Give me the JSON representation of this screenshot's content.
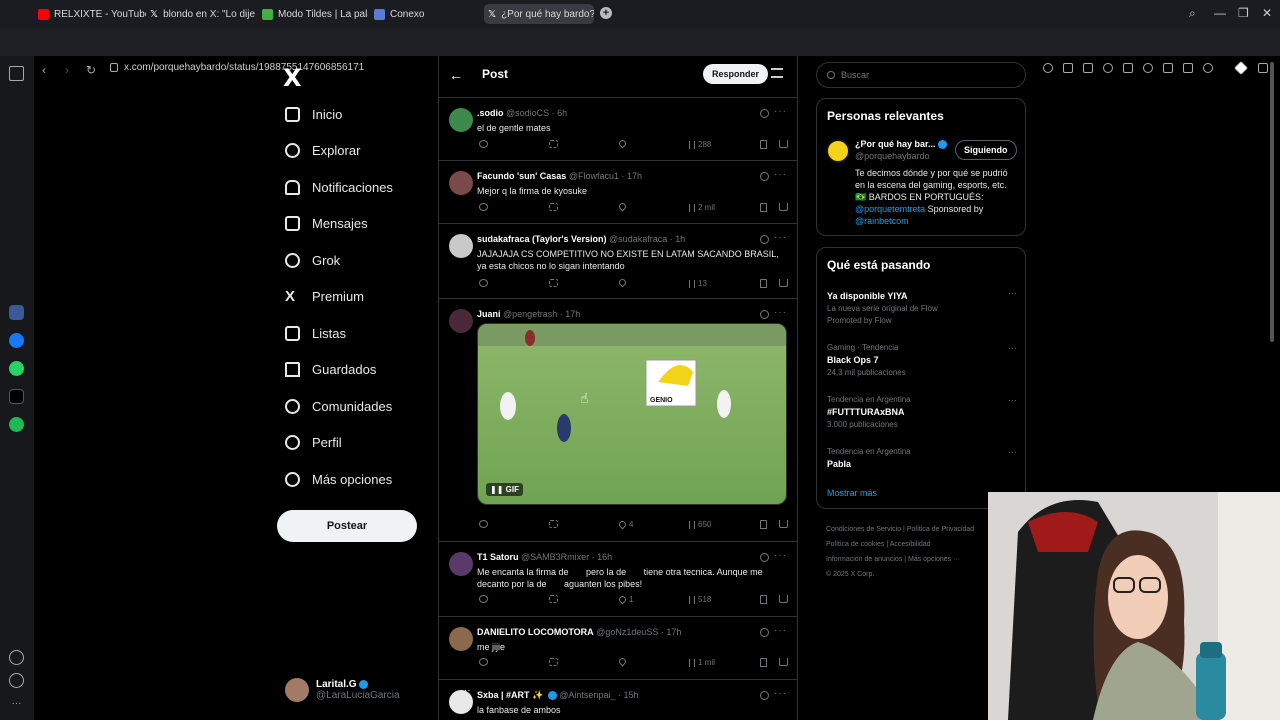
{
  "browser": {
    "tabs": [
      {
        "label": "RELXIXTE - YouTube",
        "color": "#ff0000"
      },
      {
        "label": "blondo en X: \"Lo dije adi",
        "color": "#ffffff"
      },
      {
        "label": "Modo Tildes | La palabra c",
        "color": "#43b047"
      },
      {
        "label": "Conexo",
        "color": "#5b7bd5"
      },
      {
        "label": "¿Por qué hay bardo? en X",
        "color": "#ffffff",
        "active": true
      }
    ],
    "url": "x.com/porquehaybardo/status/1988755147606856171"
  },
  "sidebar": {
    "logo": "X",
    "items": [
      {
        "label": "Inicio",
        "icon": "home-icon"
      },
      {
        "label": "Explorar",
        "icon": "search-icon"
      },
      {
        "label": "Notificaciones",
        "icon": "bell-icon"
      },
      {
        "label": "Mensajes",
        "icon": "mail-icon"
      },
      {
        "label": "Grok",
        "icon": "grok-icon"
      },
      {
        "label": "Premium",
        "icon": "x-premium-icon"
      },
      {
        "label": "Listas",
        "icon": "list-icon"
      },
      {
        "label": "Guardados",
        "icon": "bookmark-icon"
      },
      {
        "label": "Comunidades",
        "icon": "people-icon"
      },
      {
        "label": "Perfil",
        "icon": "person-icon"
      },
      {
        "label": "Más opciones",
        "icon": "more-circle-icon"
      }
    ],
    "post_button": "Postear",
    "account": {
      "name": "Larital.G",
      "handle": "@LaraLuciaGarcia",
      "more": "···"
    }
  },
  "main": {
    "header": {
      "title": "Post",
      "reply_button": "Responder",
      "back": "←"
    },
    "tweets": [
      {
        "name": ".sodio",
        "handle": "@sodioCS · 6h",
        "text": "el de gentle mates",
        "views": "288",
        "replies": "",
        "likes": "",
        "retweets": ""
      },
      {
        "name": "Facundo 'sun' Casas",
        "handle": "@Flowfacu1 · 17h",
        "text": "Mejor q la firma de kyosuke",
        "views": "2 mil",
        "replies": "",
        "likes": "",
        "retweets": ""
      },
      {
        "name": "sudakafraca (Taylor's Version)",
        "handle": "@sudakafraca · 1h",
        "text": "JAJAJAJA CS COMPETITIVO NO EXISTE EN LATAM SACANDO BRASIL, ya esta chicos no lo sigan intentando",
        "views": "13",
        "replies": "",
        "likes": "",
        "retweets": ""
      },
      {
        "name": "Juani",
        "handle": "@pengetrash · 17h",
        "text": "",
        "gif_label": "GIF",
        "overlay_text": "GENIO",
        "views": "650",
        "replies": "",
        "likes": "4",
        "retweets": ""
      },
      {
        "name": "T1 Satoru",
        "handle": "@SAMB3Rmixer · 16h",
        "text": "Me encanta la firma de       pero la de       tiene otra tecnica. Aunque me decanto por la de       aguanten los pibes!",
        "views": "518",
        "replies": "",
        "likes": "1",
        "retweets": ""
      },
      {
        "name": "DANIELITO LOCOMOTORA",
        "handle": "@goNz1deuSS · 17h",
        "text": "me jijie",
        "views": "1 mil",
        "replies": "",
        "likes": "",
        "retweets": ""
      },
      {
        "name": "Sxba | #ART ✨",
        "handle": "@Aintsenpai_ · 15h",
        "text": "la fanbase de ambos",
        "views": "",
        "replies": "",
        "likes": "",
        "retweets": ""
      }
    ]
  },
  "right": {
    "search_placeholder": "Buscar",
    "relevant": {
      "title": "Personas relevantes",
      "name": "¿Por qué hay bar...",
      "handle": "@porquehaybardo",
      "follow_label": "Siguiendo",
      "bio_lines": [
        "Te decimos dónde y por qué se pudrió en la escena del gaming, esports, etc.",
        "🇧🇷 BARDOS EN PORTUGUÉS:",
        "@porquetemtreta",
        " Sponsored by",
        "@rainbetcom"
      ]
    },
    "trends": {
      "title": "Qué está pasando",
      "items": [
        {
          "meta": "",
          "title": "Ya disponible YIYA",
          "sub": "La nueva serie original de Flow",
          "extra": "Promoted by Flow"
        },
        {
          "meta": "Gaming · Tendencia",
          "title": "Black Ops 7",
          "sub": "24,3 mil publicaciones"
        },
        {
          "meta": "Tendencia en Argentina",
          "title": "#FUTTTURAxBNA",
          "sub": "3.000 publicaciones"
        },
        {
          "meta": "Tendencia en Argentina",
          "title": "Pabla",
          "sub": ""
        }
      ],
      "show_more": "Mostrar más"
    },
    "footer": [
      "Condiciones de Servicio",
      "Política de Privacidad",
      "Política de cookies",
      "Accesibilidad",
      "Información de anuncios",
      "Más opciones ···",
      "© 2025 X Corp."
    ]
  },
  "colors": {
    "accent": "#1d9bf0",
    "background": "#000000",
    "border": "#2f3336",
    "muted": "#71767b"
  }
}
